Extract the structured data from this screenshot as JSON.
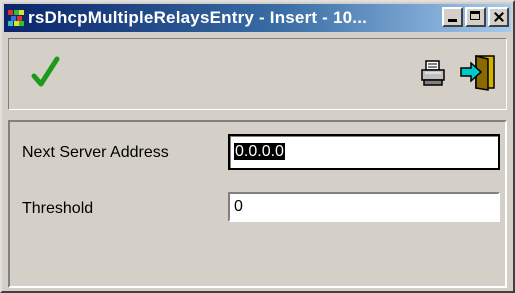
{
  "window": {
    "title": "rsDhcpMultipleRelaysEntry - Insert - 10...",
    "title_gradient": [
      "#0a246a",
      "#a6caf0"
    ]
  },
  "titlebar_buttons": [
    "minimize-icon",
    "maximize-icon",
    "close-icon"
  ],
  "toolbar": {
    "confirm_icon": "checkmark-icon",
    "confirm_color": "#1c9a1c",
    "print_icon": "printer-icon",
    "exit_icon": "exit-door-icon"
  },
  "form": {
    "next_server_address": {
      "label": "Next Server Address",
      "value": "0.0.0.0"
    },
    "threshold": {
      "label": "Threshold",
      "value": "0"
    }
  }
}
